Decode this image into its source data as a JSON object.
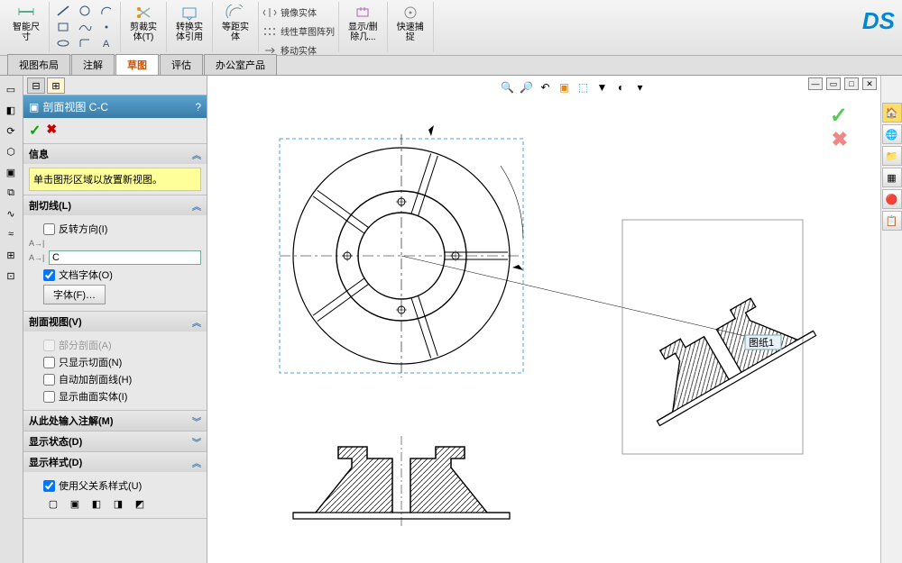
{
  "ribbon": {
    "smart_dim": "智能尺\n寸",
    "trim": "剪裁实\n体(T)",
    "convert": "转换实\n体引用",
    "offset": "等距实\n体",
    "mirror": "镜像实体",
    "linear_pattern": "线性草图阵列",
    "move": "移动实体",
    "show_delete": "显示/删\n除几...",
    "quick_snap": "快速捕\n捉"
  },
  "tabs": {
    "t1": "视图布局",
    "t2": "注解",
    "t3": "草图",
    "t4": "评估",
    "t5": "办公室产品"
  },
  "pm": {
    "title": "剖面视图 C-C",
    "help": "?",
    "info_head": "信息",
    "info_text": "单击图形区域以放置新视图。",
    "cutline_head": "剖切线(L)",
    "reverse": "反转方向(I)",
    "name_value": "C",
    "doc_font": "文档字体(O)",
    "font_btn": "字体(F)…",
    "section_head": "剖面视图(V)",
    "partial": "部分剖面(A)",
    "only_cut": "只显示切面(N)",
    "auto_hatch": "自动加剖面线(H)",
    "show_surface": "显示曲面实体(I)",
    "import_head": "从此处输入注解(M)",
    "disp_state_head": "显示状态(D)",
    "disp_style_head": "显示样式(D)",
    "use_parent": "使用父关系样式(U)"
  },
  "canvas": {
    "sheet_label": "图纸1"
  }
}
